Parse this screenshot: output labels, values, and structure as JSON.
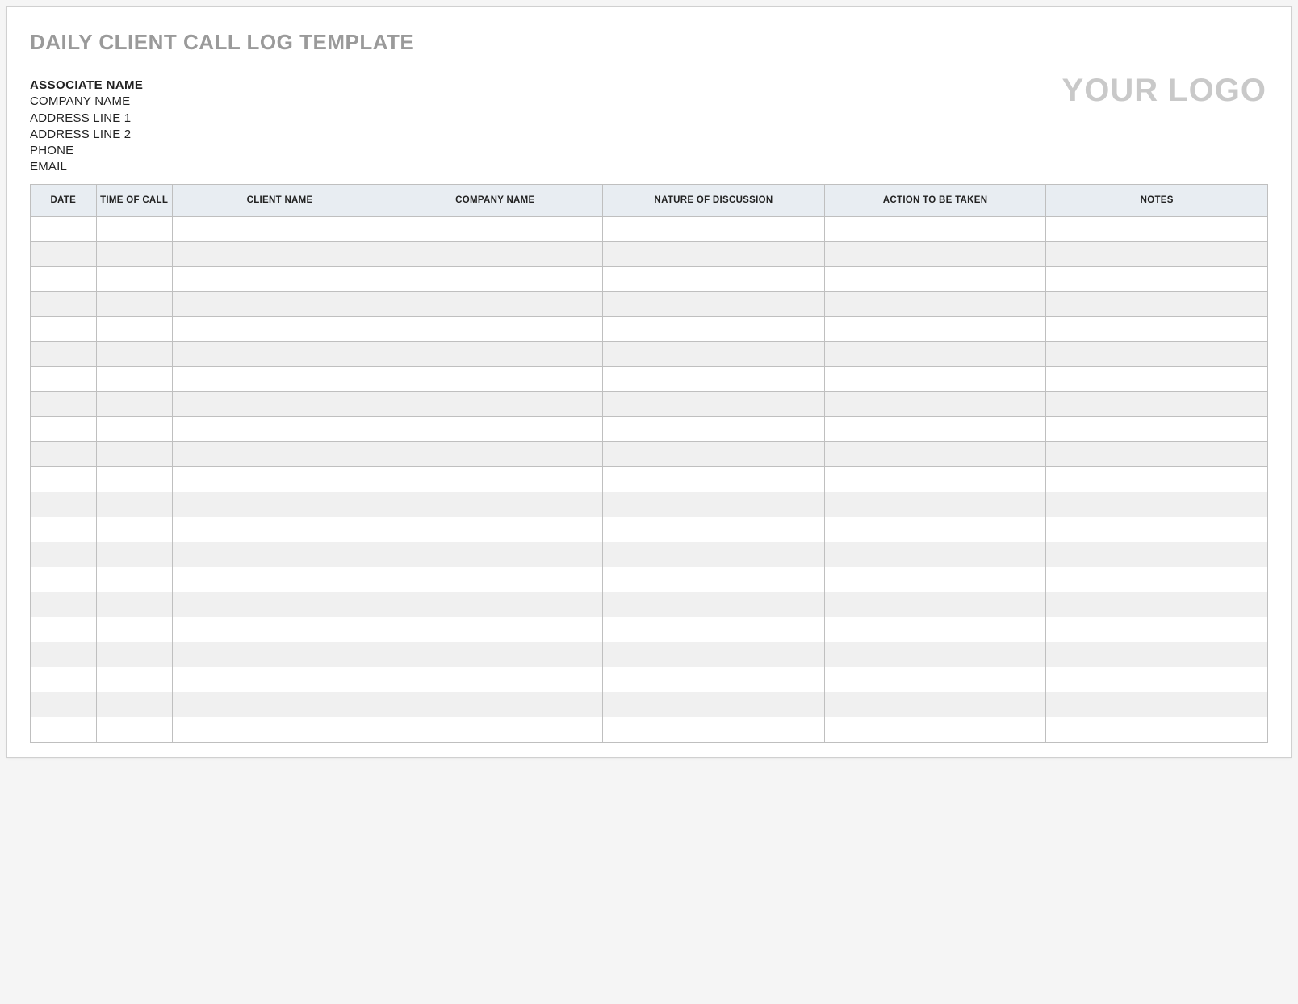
{
  "title": "DAILY CLIENT CALL LOG TEMPLATE",
  "logo_text": "YOUR LOGO",
  "meta": {
    "associate_name": "ASSOCIATE NAME",
    "company_name": "COMPANY NAME",
    "address_1": "ADDRESS LINE 1",
    "address_2": "ADDRESS LINE 2",
    "phone": "PHONE",
    "email": "EMAIL"
  },
  "table": {
    "headers": {
      "date": "DATE",
      "time_of_call": "TIME OF CALL",
      "client_name": "CLIENT NAME",
      "company_name": "COMPANY NAME",
      "nature": "NATURE OF DISCUSSION",
      "action": "ACTION TO BE TAKEN",
      "notes": "NOTES"
    },
    "row_count": 21,
    "rows": [
      {
        "date": "",
        "time_of_call": "",
        "client_name": "",
        "company_name": "",
        "nature": "",
        "action": "",
        "notes": ""
      },
      {
        "date": "",
        "time_of_call": "",
        "client_name": "",
        "company_name": "",
        "nature": "",
        "action": "",
        "notes": ""
      },
      {
        "date": "",
        "time_of_call": "",
        "client_name": "",
        "company_name": "",
        "nature": "",
        "action": "",
        "notes": ""
      },
      {
        "date": "",
        "time_of_call": "",
        "client_name": "",
        "company_name": "",
        "nature": "",
        "action": "",
        "notes": ""
      },
      {
        "date": "",
        "time_of_call": "",
        "client_name": "",
        "company_name": "",
        "nature": "",
        "action": "",
        "notes": ""
      },
      {
        "date": "",
        "time_of_call": "",
        "client_name": "",
        "company_name": "",
        "nature": "",
        "action": "",
        "notes": ""
      },
      {
        "date": "",
        "time_of_call": "",
        "client_name": "",
        "company_name": "",
        "nature": "",
        "action": "",
        "notes": ""
      },
      {
        "date": "",
        "time_of_call": "",
        "client_name": "",
        "company_name": "",
        "nature": "",
        "action": "",
        "notes": ""
      },
      {
        "date": "",
        "time_of_call": "",
        "client_name": "",
        "company_name": "",
        "nature": "",
        "action": "",
        "notes": ""
      },
      {
        "date": "",
        "time_of_call": "",
        "client_name": "",
        "company_name": "",
        "nature": "",
        "action": "",
        "notes": ""
      },
      {
        "date": "",
        "time_of_call": "",
        "client_name": "",
        "company_name": "",
        "nature": "",
        "action": "",
        "notes": ""
      },
      {
        "date": "",
        "time_of_call": "",
        "client_name": "",
        "company_name": "",
        "nature": "",
        "action": "",
        "notes": ""
      },
      {
        "date": "",
        "time_of_call": "",
        "client_name": "",
        "company_name": "",
        "nature": "",
        "action": "",
        "notes": ""
      },
      {
        "date": "",
        "time_of_call": "",
        "client_name": "",
        "company_name": "",
        "nature": "",
        "action": "",
        "notes": ""
      },
      {
        "date": "",
        "time_of_call": "",
        "client_name": "",
        "company_name": "",
        "nature": "",
        "action": "",
        "notes": ""
      },
      {
        "date": "",
        "time_of_call": "",
        "client_name": "",
        "company_name": "",
        "nature": "",
        "action": "",
        "notes": ""
      },
      {
        "date": "",
        "time_of_call": "",
        "client_name": "",
        "company_name": "",
        "nature": "",
        "action": "",
        "notes": ""
      },
      {
        "date": "",
        "time_of_call": "",
        "client_name": "",
        "company_name": "",
        "nature": "",
        "action": "",
        "notes": ""
      },
      {
        "date": "",
        "time_of_call": "",
        "client_name": "",
        "company_name": "",
        "nature": "",
        "action": "",
        "notes": ""
      },
      {
        "date": "",
        "time_of_call": "",
        "client_name": "",
        "company_name": "",
        "nature": "",
        "action": "",
        "notes": ""
      },
      {
        "date": "",
        "time_of_call": "",
        "client_name": "",
        "company_name": "",
        "nature": "",
        "action": "",
        "notes": ""
      }
    ]
  }
}
